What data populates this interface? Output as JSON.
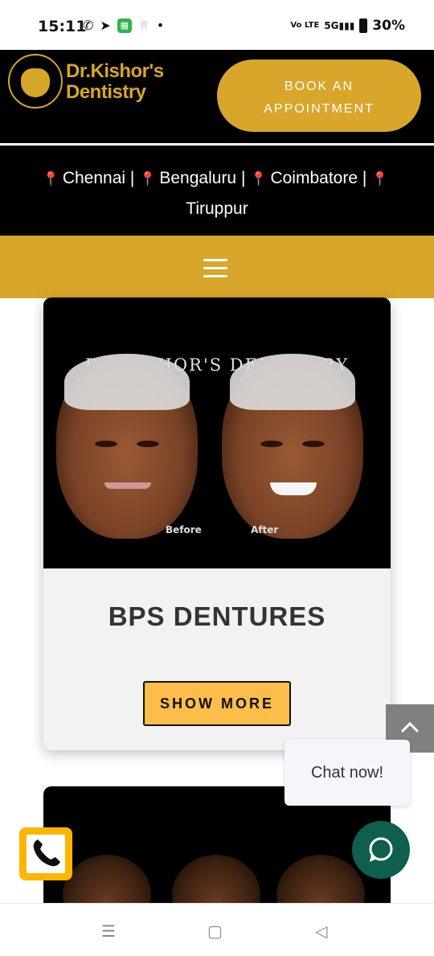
{
  "status_bar": {
    "time": "15:11",
    "left_icons": [
      "whatsapp-icon",
      "telegram-icon",
      "app-badge-icon",
      "dentist-app-icon",
      "dot-icon"
    ],
    "network_label": "Vo LTE",
    "signal_label": "5G",
    "battery_percent": "30%"
  },
  "header": {
    "logo_line1": "Dr.Kishor's",
    "logo_line2": "Dentistry",
    "logo_ring_text": "Dr.Kishor's Dentistry",
    "book_label_line1": "BOOK AN",
    "book_label_line2": "APPOINTMENT",
    "accent_color": "#d8a62a"
  },
  "locations": {
    "items": [
      "Chennai",
      "Bengaluru",
      "Coimbatore",
      "Tiruppur"
    ],
    "separator": "|"
  },
  "menu": {
    "icon": "hamburger-menu-icon"
  },
  "card": {
    "image_watermark": "DR.KISHOR'S DENTISTRY",
    "before_label": "Before",
    "after_label": "After",
    "title": "BPS DENTURES",
    "button_label": "SHOW MORE"
  },
  "chat": {
    "bubble_text": "Chat now!"
  },
  "floating": {
    "scroll_top_icon": "chevron-up-icon",
    "chat_icon": "chat-bubble-icon",
    "phone_icon": "phone-icon"
  },
  "nav": {
    "menu_icon": "recent-apps-icon",
    "home_icon": "home-icon",
    "back_icon": "back-icon"
  }
}
